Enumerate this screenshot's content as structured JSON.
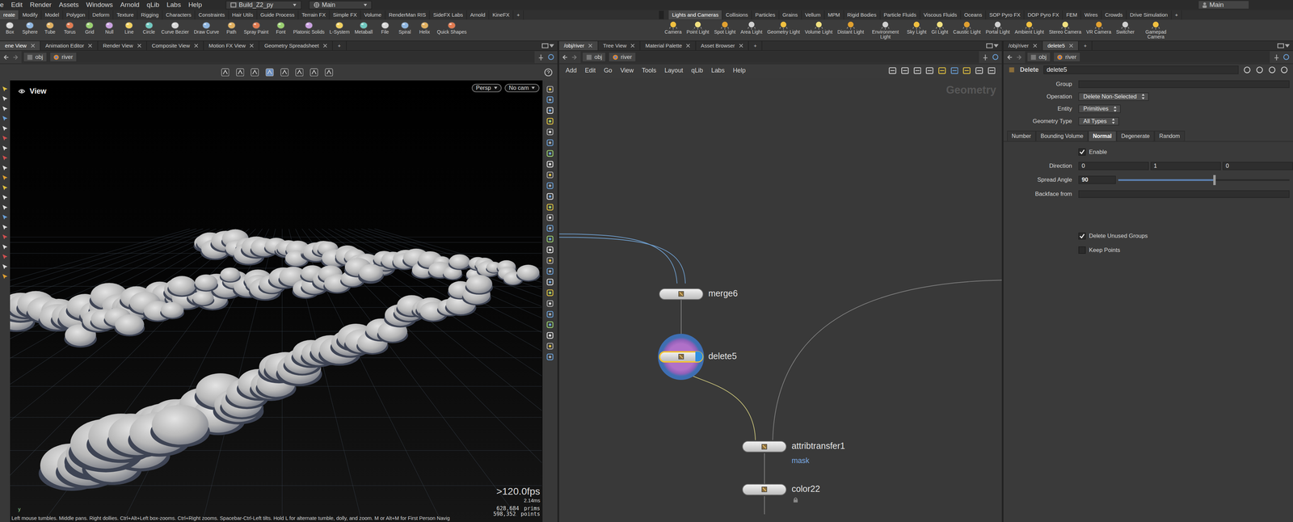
{
  "menubar": {
    "items": [
      "e",
      "Edit",
      "Render",
      "Assets",
      "Windows",
      "Arnold",
      "qLib",
      "Labs",
      "Help"
    ],
    "desktop": "Build_Z2_py",
    "session": "Main",
    "right_label": "Main"
  },
  "shelf": {
    "left_tabs": [
      {
        "label": "reate",
        "selected": true
      },
      {
        "label": "Modify",
        "selected": false
      },
      {
        "label": "Model",
        "selected": false
      },
      {
        "label": "Polygon",
        "selected": false
      },
      {
        "label": "Deform",
        "selected": false
      },
      {
        "label": "Texture",
        "selected": false
      },
      {
        "label": "Rigging",
        "selected": false
      },
      {
        "label": "Characters",
        "selected": false
      },
      {
        "label": "Constraints",
        "selected": false
      },
      {
        "label": "Hair Utils",
        "selected": false
      },
      {
        "label": "Guide Process",
        "selected": false
      },
      {
        "label": "Terrain FX",
        "selected": false
      },
      {
        "label": "Simple FX",
        "selected": false
      },
      {
        "label": "Volume",
        "selected": false
      },
      {
        "label": "RenderMan RIS",
        "selected": false
      },
      {
        "label": "SideFX Labs",
        "selected": false
      },
      {
        "label": "Arnold",
        "selected": false
      },
      {
        "label": "KineFX",
        "selected": false
      },
      {
        "label": "+",
        "selected": false
      }
    ],
    "right_tabs": [
      {
        "label": "Lights and Cameras",
        "selected": true
      },
      {
        "label": "Collisions",
        "selected": false
      },
      {
        "label": "Particles",
        "selected": false
      },
      {
        "label": "Grains",
        "selected": false
      },
      {
        "label": "Vellum",
        "selected": false
      },
      {
        "label": "MPM",
        "selected": false
      },
      {
        "label": "Rigid Bodies",
        "selected": false
      },
      {
        "label": "Particle Fluids",
        "selected": false
      },
      {
        "label": "Viscous Fluids",
        "selected": false
      },
      {
        "label": "Oceans",
        "selected": false
      },
      {
        "label": "SOP Pyro FX",
        "selected": false
      },
      {
        "label": "DOP Pyro FX",
        "selected": false
      },
      {
        "label": "FEM",
        "selected": false
      },
      {
        "label": "Wires",
        "selected": false
      },
      {
        "label": "Crowds",
        "selected": false
      },
      {
        "label": "Drive Simulation",
        "selected": false
      },
      {
        "label": "+",
        "selected": false
      }
    ],
    "left_tools": [
      "Box",
      "Sphere",
      "Tube",
      "Torus",
      "Grid",
      "Null",
      "Line",
      "Circle",
      "Curve Bezier",
      "Draw Curve",
      "Path",
      "Spray Paint",
      "Font",
      "Platonic Solids",
      "L-System",
      "Metaball",
      "File",
      "Spiral",
      "Helix",
      "Quick Shapes"
    ],
    "right_tools": [
      "Camera",
      "Point Light",
      "Spot Light",
      "Area Light",
      "Geometry Light",
      "Volume Light",
      "Distant Light",
      "Environment Light",
      "Sky Light",
      "GI Light",
      "Caustic Light",
      "Portal Light",
      "Ambient Light",
      "Stereo Camera",
      "VR Camera",
      "Switcher",
      "Gamepad Camera"
    ]
  },
  "left_pane": {
    "tabs": [
      {
        "label": "ene View",
        "selected": true
      },
      {
        "label": "Animation Editor",
        "selected": false
      },
      {
        "label": "Render View",
        "selected": false
      },
      {
        "label": "Composite View",
        "selected": false
      },
      {
        "label": "Motion FX View",
        "selected": false
      },
      {
        "label": "Geometry Spreadsheet",
        "selected": false
      },
      {
        "label": "+",
        "selected": false
      }
    ],
    "path": [
      "obj",
      "river"
    ],
    "viewport": {
      "title": "View",
      "camera": "Persp",
      "cam_menu": "No cam",
      "fps": ">120.0fps",
      "time": "2.14ms",
      "prims_count": "628,684",
      "prims_label": "prims",
      "points_count": "598,352",
      "points_label": "points",
      "axis_label": "y",
      "status": "Left mouse tumbles. Middle pans. Right dollies. Ctrl+Alt+Left box-zooms. Ctrl+Right zooms. Spacebar-Ctrl-Left tilts. Hold L for alternate tumble, dolly, and zoom. M or Alt+M for First Person Navig"
    }
  },
  "network_pane": {
    "tabs": [
      {
        "label": "/obj/river",
        "selected": true
      },
      {
        "label": "Tree View",
        "selected": false
      },
      {
        "label": "Material Palette",
        "selected": false
      },
      {
        "label": "Asset Browser",
        "selected": false
      },
      {
        "label": "+",
        "selected": false
      }
    ],
    "path": [
      "obj",
      "river"
    ],
    "menu": [
      "Add",
      "Edit",
      "Go",
      "View",
      "Tools",
      "Layout",
      "qLib",
      "Labs",
      "Help"
    ],
    "context": "Geometry",
    "nodes": [
      {
        "name": "merge6",
        "subtitle": "",
        "selected": false,
        "display": false,
        "locked": false
      },
      {
        "name": "delete5",
        "subtitle": "",
        "selected": true,
        "display": true,
        "locked": false
      },
      {
        "name": "attribtransfer1",
        "subtitle": "mask",
        "selected": false,
        "display": false,
        "locked": false
      },
      {
        "name": "color22",
        "subtitle": "",
        "selected": false,
        "display": false,
        "locked": true
      }
    ]
  },
  "param_pane": {
    "tabs": [
      {
        "label": "/obj/river",
        "selected": false
      },
      {
        "label": "delete5",
        "selected": true
      },
      {
        "label": "+",
        "selected": false
      }
    ],
    "path": [
      "obj",
      "river"
    ],
    "header": {
      "type": "Delete",
      "name": "delete5"
    },
    "rows": [
      {
        "kind": "field",
        "label": "Group",
        "value": ""
      },
      {
        "kind": "menu",
        "label": "Operation",
        "value": "Delete Non-Selected"
      },
      {
        "kind": "menu",
        "label": "Entity",
        "value": "Primitives"
      },
      {
        "kind": "menu",
        "label": "Geometry Type",
        "value": "All Types"
      }
    ],
    "tabs2": [
      {
        "label": "Number",
        "selected": false
      },
      {
        "label": "Bounding Volume",
        "selected": false
      },
      {
        "label": "Normal",
        "selected": true
      },
      {
        "label": "Degenerate",
        "selected": false
      },
      {
        "label": "Random",
        "selected": false
      }
    ],
    "normal_rows": [
      {
        "kind": "check",
        "label": "Enable",
        "checked": true
      },
      {
        "kind": "vector",
        "label": "Direction",
        "values": [
          "0",
          "1",
          "0"
        ]
      },
      {
        "kind": "slider",
        "label": "Spread Angle",
        "value": "90",
        "level": 0.56
      },
      {
        "kind": "field",
        "label": "Backface from",
        "value": ""
      }
    ],
    "bottom_checks": [
      {
        "label": "Delete Unused Groups",
        "checked": true
      },
      {
        "label": "Keep Points",
        "checked": false
      }
    ]
  }
}
